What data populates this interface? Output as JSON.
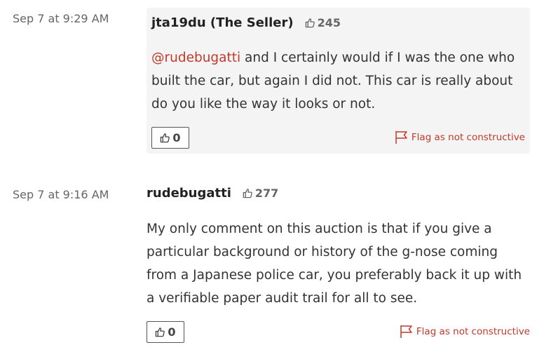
{
  "comments": [
    {
      "timestamp": "Sep 7 at 9:29 AM",
      "author": "jta19du (The Seller)",
      "likes": "245",
      "mention": "@rudebugatti",
      "text": " and I certainly would if I was the one who built the car, but again I did not. This car is really about do you like the way it looks or not.",
      "votes": "0",
      "flag_label": "Flag as not constructive"
    },
    {
      "timestamp": "Sep 7 at 9:16 AM",
      "author": "rudebugatti",
      "likes": "277",
      "text": "My only comment on this auction is that if you give a particular background or history of the g-nose coming from a Japanese police car, you preferably back it up with a verifiable paper audit trail for all to see.",
      "votes": "0",
      "flag_label": "Flag as not constructive"
    }
  ],
  "colors": {
    "accent": "#c0392b",
    "seller_bg": "#f4f4f4"
  }
}
